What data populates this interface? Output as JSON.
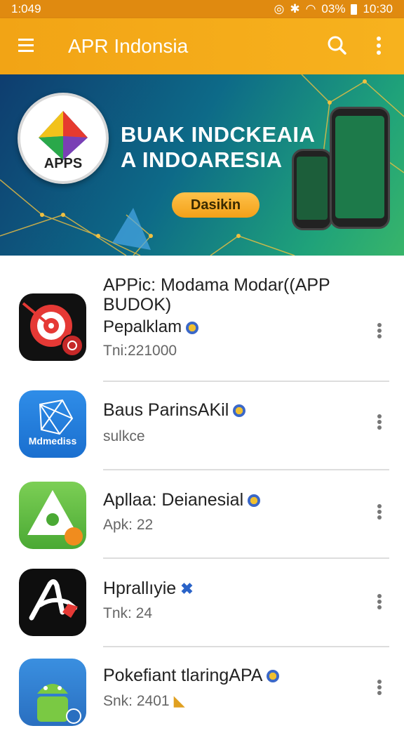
{
  "status_bar": {
    "time_left": "1:049",
    "battery": "03%",
    "clock": "10:30"
  },
  "app_bar": {
    "title": "APR Indonsia",
    "menu_icon": "hamburger-icon",
    "search_icon": "search-icon",
    "more_icon": "more-vert-icon"
  },
  "banner": {
    "logo_text": "APPS",
    "headline_line1": "BUAK INDCKEAIA",
    "headline_line2": "A INDOARESIA",
    "button_label": "Dasikin"
  },
  "apps": [
    {
      "title": "APPic: Modama Modar((APP BUDOK)",
      "subtitle": "Pepalklam",
      "meta": "Tni:221000",
      "badge": "mascot"
    },
    {
      "title": "Baus ParinsAKil",
      "subtitle": "sulkce",
      "badge": "mascot",
      "icon_text": "Mdmediss"
    },
    {
      "title": "Apllaa: Deianesial",
      "subtitle": "Apk: 22",
      "badge": "mascot"
    },
    {
      "title": "Hprallıyie",
      "subtitle": "Tnk: 24",
      "badge": "x-mark"
    },
    {
      "title": "Pokefiant tlaringAPA",
      "subtitle": "Snk: 2401",
      "badge": "mascot"
    }
  ],
  "colors": {
    "appbar": "#f2a415",
    "status": "#e08a10",
    "accent_orange": "#f3a018",
    "banner_teal": "#0d6a88"
  }
}
